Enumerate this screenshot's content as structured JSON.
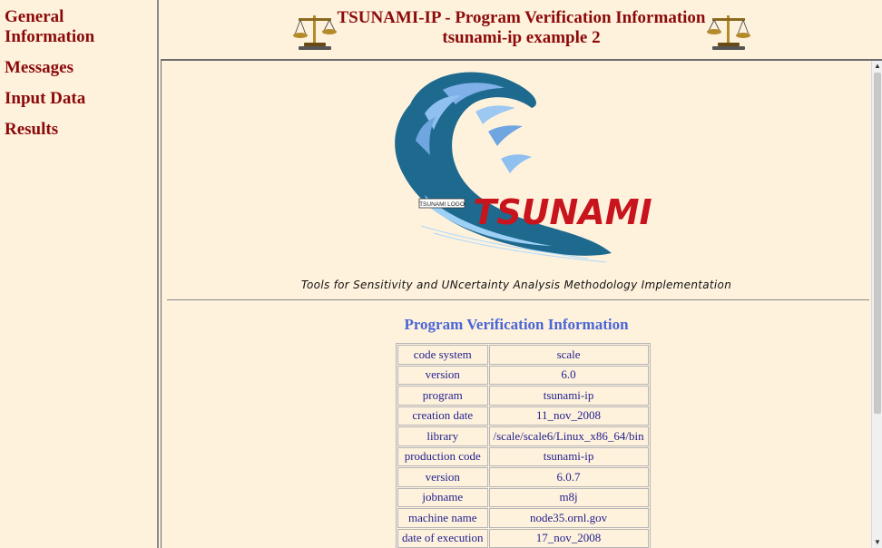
{
  "nav": {
    "items": [
      "General Information",
      "Messages",
      "Input Data",
      "Results"
    ]
  },
  "header": {
    "title_line1": "TSUNAMI-IP - Program Verification Information",
    "title_line2": "tsunami-ip example 2"
  },
  "logo": {
    "word": "TSUNAMI",
    "alt_label": "TSUNAMI LOGO",
    "tagline": "Tools for Sensitivity and UNcertainty Analysis Methodology Implementation"
  },
  "section_title": "Program Verification Information",
  "info_rows": [
    {
      "key": "code system",
      "value": "scale"
    },
    {
      "key": "version",
      "value": "6.0"
    },
    {
      "key": "program",
      "value": "tsunami-ip"
    },
    {
      "key": "creation date",
      "value": "11_nov_2008"
    },
    {
      "key": "library",
      "value": "/scale/scale6/Linux_x86_64/bin"
    },
    {
      "key": "production code",
      "value": "tsunami-ip"
    },
    {
      "key": "version",
      "value": "6.0.7"
    },
    {
      "key": "jobname",
      "value": "m8j"
    },
    {
      "key": "machine name",
      "value": "node35.ornl.gov"
    },
    {
      "key": "date of execution",
      "value": "17_nov_2008"
    }
  ],
  "colors": {
    "background": "#fff2dd",
    "nav_link": "#8b0a0a",
    "section_title": "#4966d6",
    "table_text": "#1f1f8c",
    "wave": "#1e6a8f",
    "logo_word": "#c8141c"
  },
  "icons": [
    "scale-balance-icon",
    "scroll-up-icon",
    "scroll-down-icon"
  ]
}
